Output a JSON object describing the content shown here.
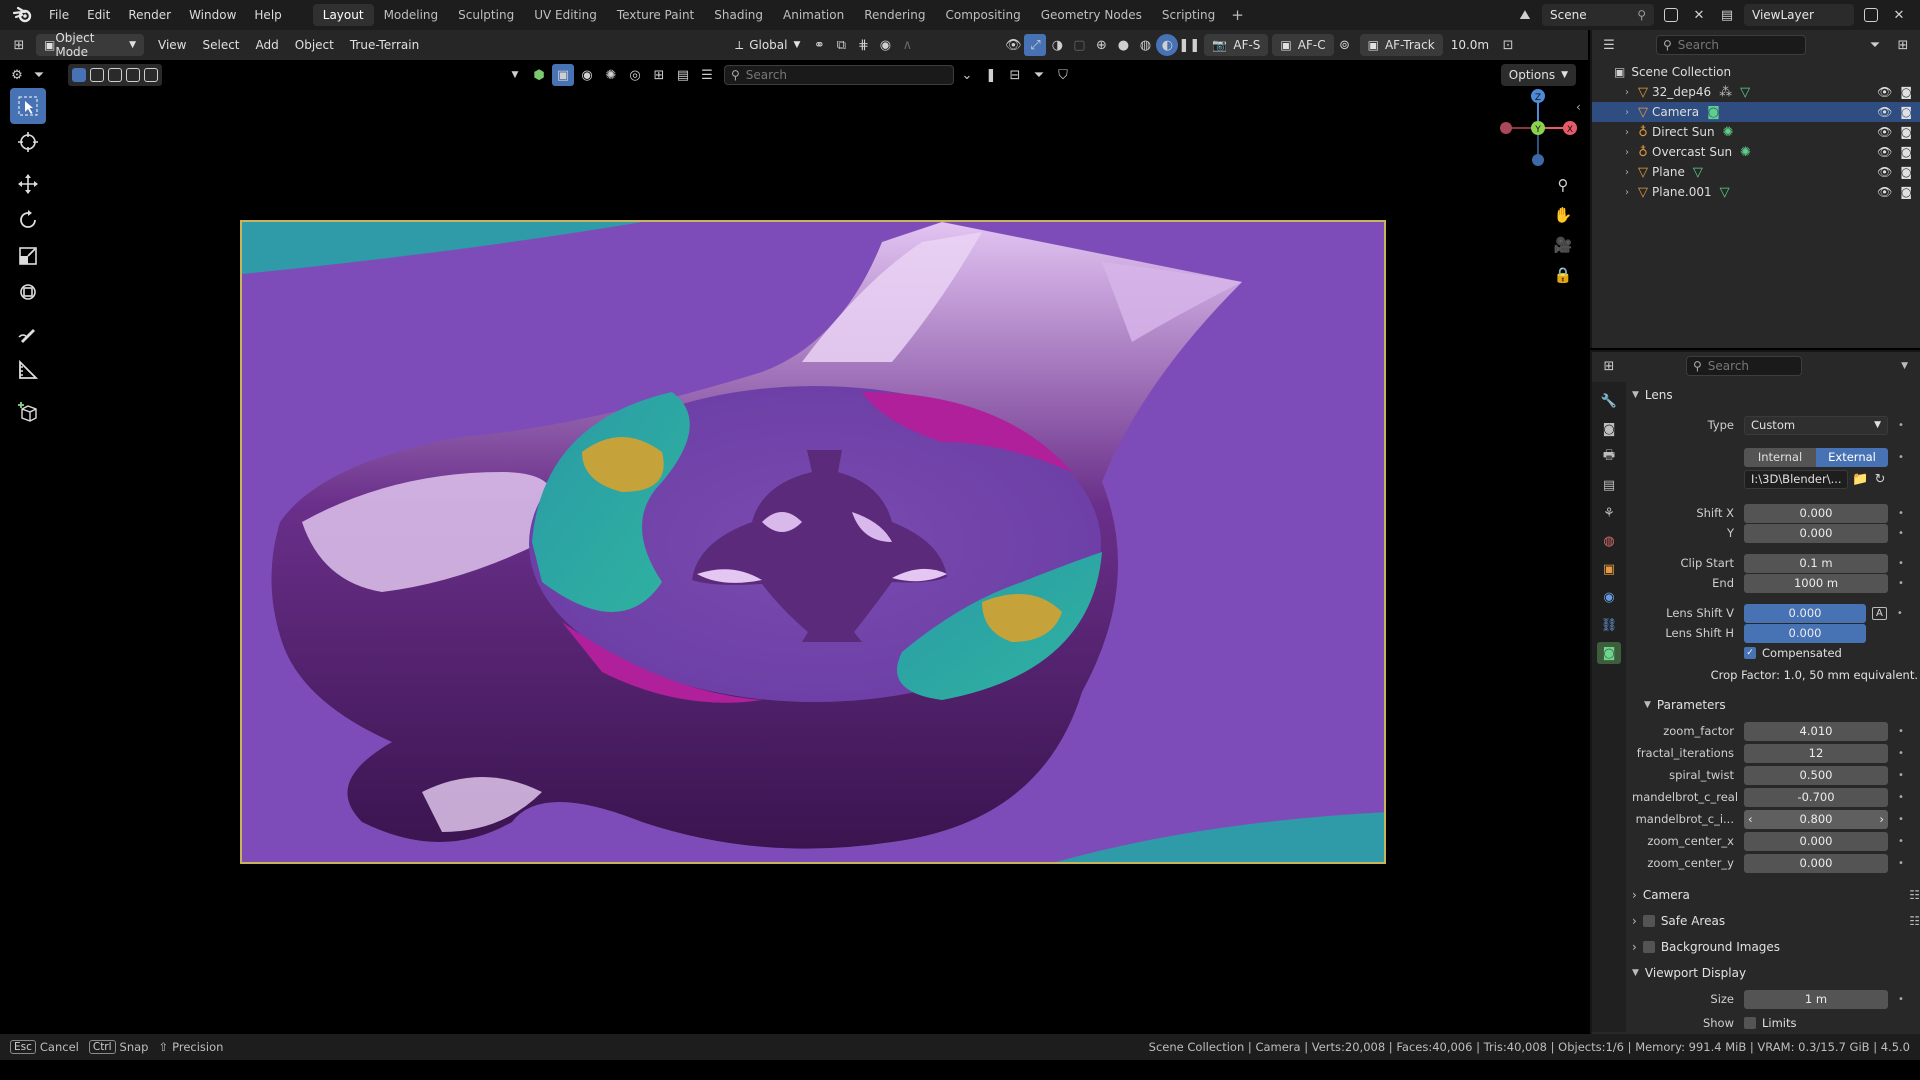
{
  "app": {
    "name": "Blender"
  },
  "menu": [
    "File",
    "Edit",
    "Render",
    "Window",
    "Help"
  ],
  "workspaces": [
    "Layout",
    "Modeling",
    "Sculpting",
    "UV Editing",
    "Texture Paint",
    "Shading",
    "Animation",
    "Rendering",
    "Compositing",
    "Geometry Nodes",
    "Scripting"
  ],
  "active_workspace": "Layout",
  "scene": {
    "name": "Scene",
    "view_layer": "ViewLayer"
  },
  "header": {
    "mode": "Object Mode",
    "menus": [
      "View",
      "Select",
      "Add",
      "Object",
      "True-Terrain"
    ],
    "orientation": "Global",
    "af_s": "AF-S",
    "af_c": "AF-C",
    "af_track": "AF-Track",
    "distance": "10.0m",
    "search_placeholder": "Search",
    "options": "Options"
  },
  "outliner": {
    "search_placeholder": "Search",
    "collection": "Scene Collection",
    "items": [
      {
        "name": "32_dep46",
        "selected": false
      },
      {
        "name": "Camera",
        "selected": true
      },
      {
        "name": "Direct Sun",
        "selected": false
      },
      {
        "name": "Overcast Sun",
        "selected": false
      },
      {
        "name": "Plane",
        "selected": false
      },
      {
        "name": "Plane.001",
        "selected": false
      }
    ]
  },
  "properties": {
    "search_placeholder": "Search",
    "lens_panel": "Lens",
    "type_label": "Type",
    "type_value": "Custom",
    "internal": "Internal",
    "external": "External",
    "path": "I:\\3D\\Blender\\...",
    "shift_x_label": "Shift X",
    "shift_x": "0.000",
    "shift_y_label": "Y",
    "shift_y": "0.000",
    "clip_start_label": "Clip Start",
    "clip_start": "0.1 m",
    "clip_end_label": "End",
    "clip_end": "1000 m",
    "lens_shift_v_label": "Lens Shift V",
    "lens_shift_v": "0.000",
    "lens_shift_h_label": "Lens Shift H",
    "lens_shift_h": "0.000",
    "compensated": "Compensated",
    "crop_factor": "Crop Factor: 1.0, 50 mm equivalent.",
    "parameters_panel": "Parameters",
    "params": [
      {
        "label": "zoom_factor",
        "value": "4.010"
      },
      {
        "label": "fractal_iterations",
        "value": "12"
      },
      {
        "label": "spiral_twist",
        "value": "0.500"
      },
      {
        "label": "mandelbrot_c_real",
        "value": "-0.700"
      },
      {
        "label": "mandelbrot_c_i...",
        "value": "0.800"
      },
      {
        "label": "zoom_center_x",
        "value": "0.000"
      },
      {
        "label": "zoom_center_y",
        "value": "0.000"
      }
    ],
    "camera_panel": "Camera",
    "safe_areas_panel": "Safe Areas",
    "background_images_panel": "Background Images",
    "viewport_display_panel": "Viewport Display",
    "size_label": "Size",
    "size_value": "1 m",
    "show_label": "Show",
    "limits": "Limits"
  },
  "status": {
    "cancel_key": "Esc",
    "cancel": "Cancel",
    "snap_key": "Ctrl",
    "snap": "Snap",
    "precision": "Precision",
    "stats": "Scene Collection | Camera | Verts:20,008 | Faces:40,006 | Tris:40,008 | Objects:1/6 | Memory: 991.4 MiB | VRAM: 0.3/15.7 GiB | 4.5.0"
  },
  "colors": {
    "accent": "#4772b3",
    "object_icon": "#e49a41",
    "data_icon": "#5fce8c",
    "frame": "#c8b45a"
  }
}
